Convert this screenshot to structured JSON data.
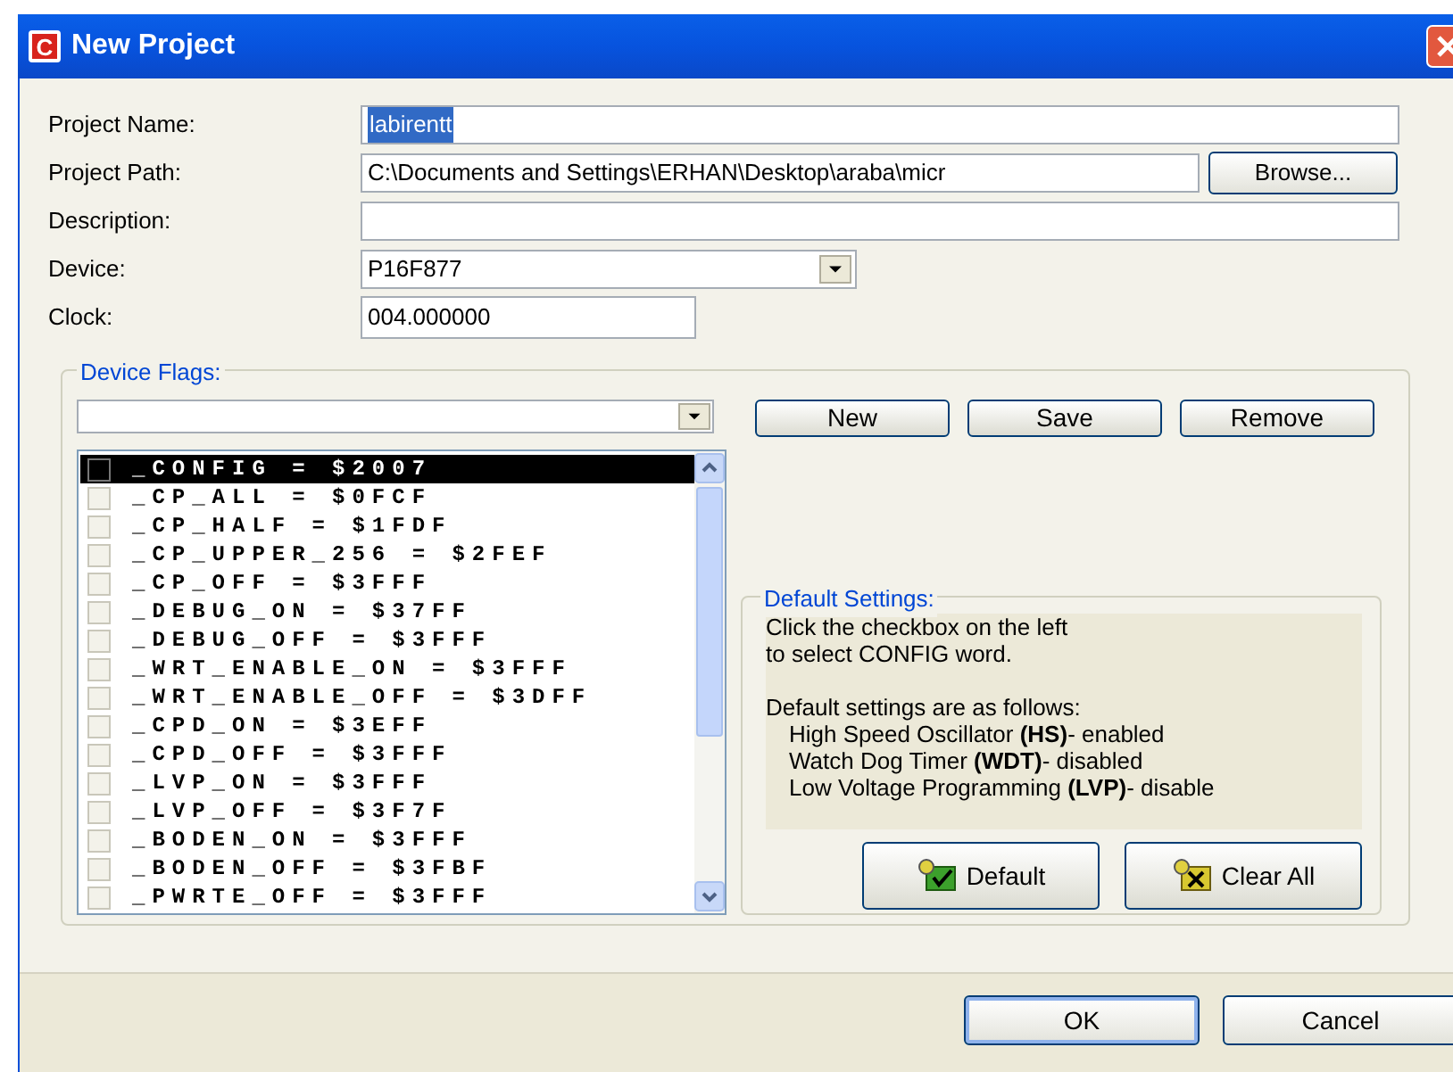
{
  "window": {
    "title": "New Project",
    "logo_letter": "C"
  },
  "fields": [
    {
      "kind": "text",
      "label": "Project Name:",
      "value": "labirentt",
      "selected": true
    },
    {
      "kind": "browse",
      "label": "Project Path:",
      "value": "C:\\Documents and Settings\\ERHAN\\Desktop\\araba\\micr",
      "button": "Browse..."
    },
    {
      "kind": "text",
      "label": "Description:"
    },
    {
      "kind": "combo",
      "label": "Device:",
      "value": "P16F877"
    },
    {
      "kind": "short",
      "label": "Clock:",
      "value": "004.000000"
    }
  ],
  "device_flags": {
    "title": "Device Flags:",
    "buttons": [
      "New",
      "Save",
      "Remove"
    ],
    "items": [
      {
        "label": "_CONFIG = $2007",
        "selected": true,
        "checked": false
      },
      {
        "label": "_CP_ALL = $0FCF",
        "selected": false,
        "checked": false
      },
      {
        "label": "_CP_HALF = $1FDF",
        "selected": false,
        "checked": false
      },
      {
        "label": "_CP_UPPER_256 = $2FEF",
        "selected": false,
        "checked": false
      },
      {
        "label": "_CP_OFF = $3FFF",
        "selected": false,
        "checked": false
      },
      {
        "label": "_DEBUG_ON = $37FF",
        "selected": false,
        "checked": false
      },
      {
        "label": "_DEBUG_OFF = $3FFF",
        "selected": false,
        "checked": false
      },
      {
        "label": "_WRT_ENABLE_ON = $3FFF",
        "selected": false,
        "checked": false
      },
      {
        "label": "_WRT_ENABLE_OFF = $3DFF",
        "selected": false,
        "checked": false
      },
      {
        "label": "_CPD_ON = $3EFF",
        "selected": false,
        "checked": false
      },
      {
        "label": "_CPD_OFF = $3FFF",
        "selected": false,
        "checked": false
      },
      {
        "label": "_LVP_ON = $3FFF",
        "selected": false,
        "checked": false
      },
      {
        "label": "_LVP_OFF = $3F7F",
        "selected": false,
        "checked": false
      },
      {
        "label": "_BODEN_ON = $3FFF",
        "selected": false,
        "checked": false
      },
      {
        "label": "_BODEN_OFF = $3FBF",
        "selected": false,
        "checked": false
      },
      {
        "label": "_PWRTE_OFF = $3FFF",
        "selected": false,
        "checked": false
      }
    ],
    "default_settings": {
      "title": "Default Settings:",
      "lines": [
        "Click the checkbox on the left",
        "to select CONFIG word."
      ],
      "heading": "Default settings are as follows:",
      "details": [
        "High Speed Oscillator **(HS)**- enabled",
        "Watch Dog Timer **(WDT)**- disabled",
        "Low Voltage Programming **(LVP)**- disable"
      ],
      "buttons": [
        {
          "kind": "default",
          "label": "Default"
        },
        {
          "kind": "clear",
          "label": "Clear All"
        }
      ]
    }
  },
  "footer_buttons": [
    {
      "label": "OK",
      "selected": true
    },
    {
      "label": "Cancel",
      "selected": false
    }
  ]
}
